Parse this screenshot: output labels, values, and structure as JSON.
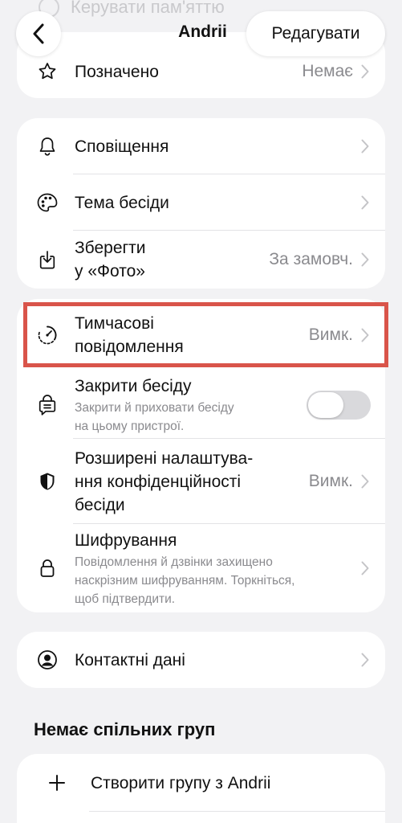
{
  "ghost_row": {
    "label": "Керувати пам'яттю"
  },
  "nav": {
    "title": "Andrii",
    "edit_label": "Редагувати"
  },
  "top_card": {
    "marked": {
      "label": "Позначено",
      "value": "Немає"
    }
  },
  "card_notifications": {
    "notifications": {
      "label": "Сповіщення"
    },
    "theme": {
      "label": "Тема бесіди"
    },
    "save_photos": {
      "label_line1": "Зберегти",
      "label_line2": "у «Фото»",
      "value": "За замовч."
    }
  },
  "card_privacy": {
    "disappearing": {
      "label_line1": "Тимчасові",
      "label_line2": "повідомлення",
      "value": "Вимк."
    },
    "lock_chat": {
      "label": "Закрити бесіду",
      "sub_line1": "Закрити й приховати бесіду",
      "sub_line2": "на цьому пристрої.",
      "toggle_on": false
    },
    "advanced_privacy": {
      "label_line1": "Розширені налаштува-",
      "label_line2": "ння конфіденційності",
      "label_line3": "бесіди",
      "value": "Вимк."
    },
    "encryption": {
      "label": "Шифрування",
      "sub_line1": "Повідомлення й дзвінки захищено",
      "sub_line2": "наскрізним шифруванням. Торкніться,",
      "sub_line3": "щоб підтвердити."
    }
  },
  "card_contact": {
    "contact_info": {
      "label": "Контактні дані"
    }
  },
  "groups": {
    "section_title": "Немає спільних груп",
    "create_group": {
      "label": "Створити групу з Andrii"
    }
  },
  "colors": {
    "background": "#f2f2f4",
    "card": "#ffffff",
    "secondary_text": "#8a8a8e",
    "highlight": "#d9544a"
  }
}
